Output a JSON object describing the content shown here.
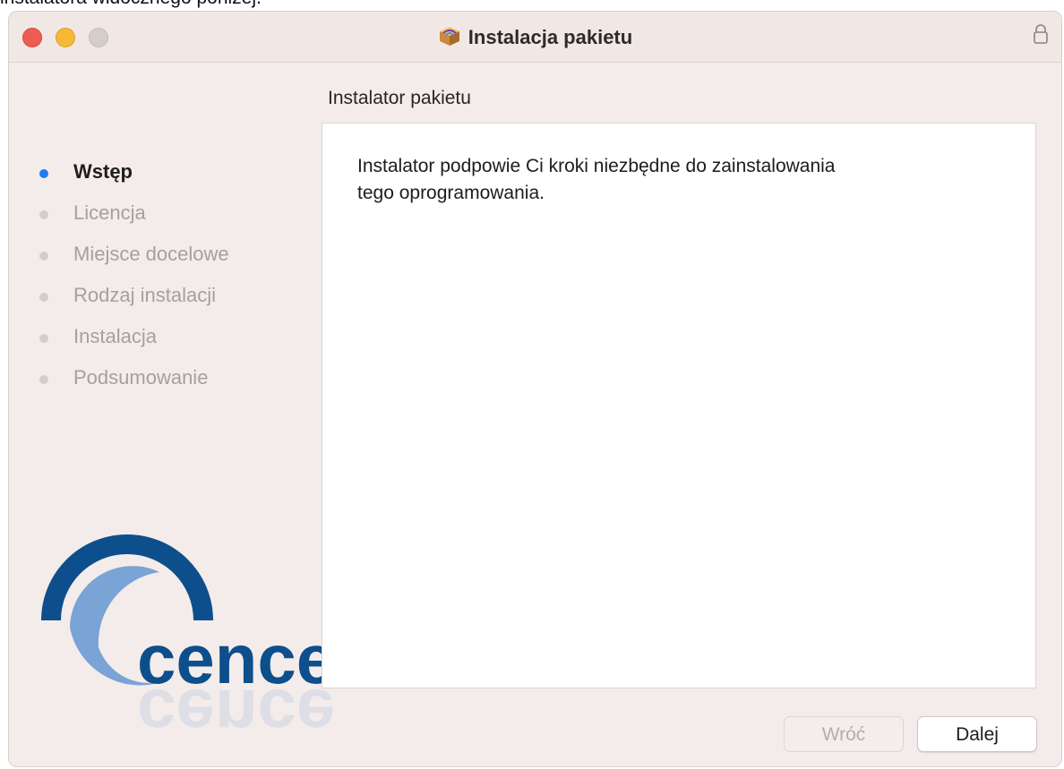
{
  "document": {
    "fragment_text": "instalatora widocznego poniżej."
  },
  "window": {
    "title": "Instalacja pakietu",
    "title_icon": "package-icon",
    "lock_icon": "lock-icon"
  },
  "panel": {
    "heading": "Instalator pakietu",
    "body_line1": "Instalator podpowie Ci kroki niezbędne do zainstalowania",
    "body_line2": "tego oprogramowania."
  },
  "steps": [
    {
      "label": "Wstęp",
      "active": true
    },
    {
      "label": "Licencja",
      "active": false
    },
    {
      "label": "Miejsce docelowe",
      "active": false
    },
    {
      "label": "Rodzaj instalacji",
      "active": false
    },
    {
      "label": "Instalacja",
      "active": false
    },
    {
      "label": "Podsumowanie",
      "active": false
    }
  ],
  "logo": {
    "text": "cence",
    "colors": {
      "dark_blue": "#0d4f8c",
      "light_blue": "#7aa3d6"
    }
  },
  "buttons": {
    "back_label": "Wróć",
    "next_label": "Dalej"
  },
  "colors": {
    "accent": "#1f7cf6",
    "close": "#ee5b52",
    "minimize": "#f5b936",
    "zoom_disabled": "#d4cdca"
  }
}
